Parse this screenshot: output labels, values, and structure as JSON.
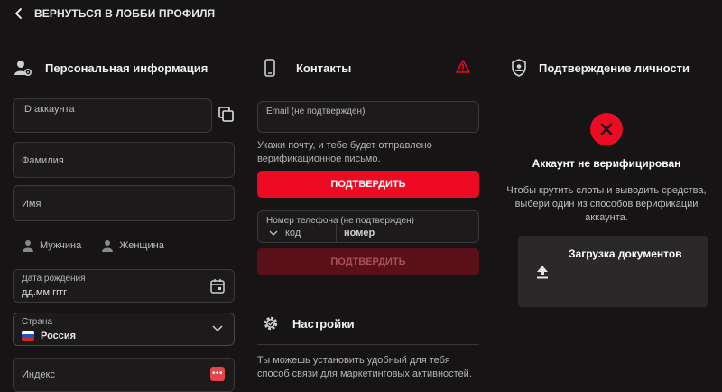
{
  "topbar": {
    "back_label": "ВЕРНУТЬСЯ В ЛОББИ ПРОФИЛЯ"
  },
  "personal": {
    "title": "Персональная информация",
    "account_id_label": "ID аккаунта",
    "surname_placeholder": "Фамилия",
    "name_placeholder": "Имя",
    "gender_male": "Мужчина",
    "gender_female": "Женщина",
    "birthdate_label": "Дата рождения",
    "birthdate_placeholder": "дд.мм.гггг",
    "country_label": "Страна",
    "country_value": "Россия",
    "zip_placeholder": "Индекс"
  },
  "contacts": {
    "title": "Контакты",
    "email_label": "Email (не подтвержден)",
    "email_help": "Укажи почту, и тебе будет отправлено верификационное письмо.",
    "confirm_email_button": "ПОДТВЕРДИТЬ",
    "phone_label": "Номер телефона (не подтвержден)",
    "phone_code": "код",
    "phone_number_placeholder": "номер",
    "confirm_phone_button": "ПОДТВЕРДИТЬ"
  },
  "settings": {
    "title": "Настройки",
    "text": "Ты можешь установить удобный для тебя способ связи для маркетинговых активностей."
  },
  "verification": {
    "title": "Подтверждение личности",
    "status": "Аккаунт не верифицирован",
    "text": "Чтобы крутить слоты и выводить средства, выбери один из способов верификации аккаунта.",
    "documents_upload": "Загрузка документов"
  },
  "colors": {
    "accent_red": "#ee0a22",
    "disabled_red": "#5a1018",
    "background": "#161414",
    "field_border": "#3b3838",
    "card_bg": "#2a2828"
  }
}
